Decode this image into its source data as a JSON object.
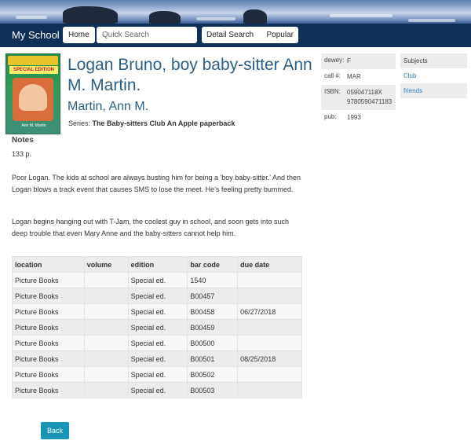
{
  "nav": {
    "brand": "My School",
    "home": "Home",
    "search_placeholder": "Quick Search",
    "detail_search": "Detail Search",
    "popular": "Popular"
  },
  "book": {
    "cover_special": "SPECIAL EDITION",
    "title": "Logan Bruno, boy baby-sitter Ann M. Martin.",
    "author": "Martin, Ann M.",
    "series_label": "Series:",
    "series": "The Baby-sitters Club An Apple paperback"
  },
  "info": [
    {
      "key": "dewey:",
      "value": "F"
    },
    {
      "key": "call #:",
      "value": "MAR"
    },
    {
      "key": "ISBN:",
      "value": "059047118X 9780590471183"
    },
    {
      "key": "pub:",
      "value": "1993"
    }
  ],
  "subjects": {
    "heading": "Subjects",
    "items": [
      "Club",
      "friends"
    ]
  },
  "notes": {
    "heading": "Notes",
    "pages": "133 p.",
    "paragraphs": [
      "Poor Logan. The kids at school are always busting him for being a 'boy baby-sitter.' And then Logan blows a track event that causes SMS to lose the meet. He's feeling pretty bummed.",
      "Logan begins hanging out with T-Jam, the coolest guy in school, and soon gets into such deep trouble that even Mary Anne and the baby-sitters cannot help him."
    ]
  },
  "copies": {
    "headers": [
      "location",
      "volume",
      "edition",
      "bar code",
      "due date"
    ],
    "rows": [
      [
        "Picture Books",
        "",
        "Special ed.",
        "1540",
        ""
      ],
      [
        "Picture Books",
        "",
        "Special ed.",
        "B00457",
        ""
      ],
      [
        "Picture Books",
        "",
        "Special ed.",
        "B00458",
        "06/27/2018"
      ],
      [
        "Picture Books",
        "",
        "Special ed.",
        "B00459",
        ""
      ],
      [
        "Picture Books",
        "",
        "Special ed.",
        "B00500",
        ""
      ],
      [
        "Picture Books",
        "",
        "Special ed.",
        "B00501",
        "08/25/2018"
      ],
      [
        "Picture Books",
        "",
        "Special ed.",
        "B00502",
        ""
      ],
      [
        "Picture Books",
        "",
        "Special ed.",
        "B00503",
        ""
      ]
    ]
  },
  "back_label": "Back",
  "colors": {
    "navbar": "#0e2f57",
    "title": "#2a5f88",
    "link": "#2a7cc0",
    "back_button": "#1a94b5"
  }
}
